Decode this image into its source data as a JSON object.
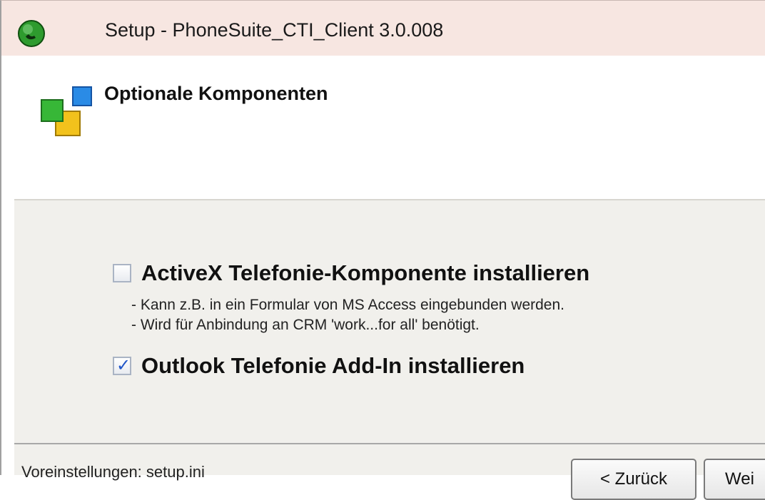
{
  "window": {
    "title": "Setup - PhoneSuite_CTI_Client 3.0.008",
    "icon": "phone-icon"
  },
  "header": {
    "title": "Optionale Komponenten",
    "icon": "components-icon"
  },
  "options": [
    {
      "label": "ActiveX Telefonie-Komponente installieren",
      "checked": false,
      "description": [
        "- Kann z.B. in ein Formular von MS Access eingebunden werden.",
        "- Wird für Anbindung an CRM 'work...for all' benötigt."
      ]
    },
    {
      "label": "Outlook Telefonie Add-In installieren",
      "checked": true,
      "description": []
    }
  ],
  "footer": {
    "status_text": "Voreinstellungen: setup.ini",
    "back_label": "< Zurück",
    "next_label": "Wei"
  },
  "colors": {
    "titlebar": "#f7e6e1",
    "body": "#f1f0ec",
    "check_accent": "#1f55c8"
  }
}
